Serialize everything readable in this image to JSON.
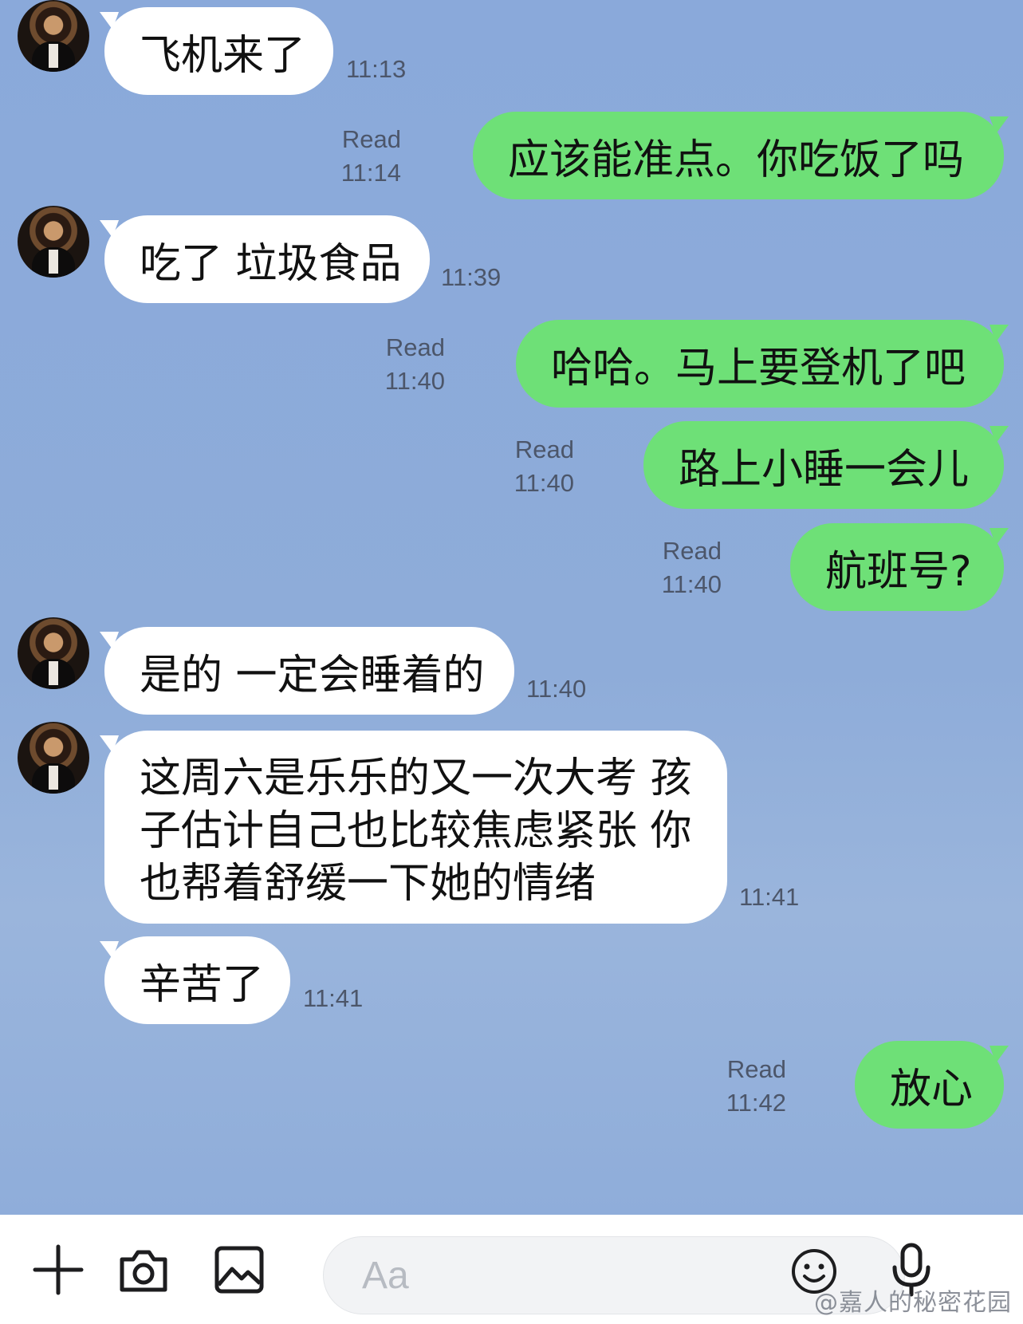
{
  "messages": [
    {
      "side": "in",
      "text": "飞机来了",
      "time": "11:13"
    },
    {
      "side": "out",
      "text": "应该能准点。你吃饭了吗",
      "read": "Read",
      "time": "11:14"
    },
    {
      "side": "in",
      "text": "吃了 垃圾食品",
      "time": "11:39"
    },
    {
      "side": "out",
      "text": "哈哈。马上要登机了吧",
      "read": "Read",
      "time": "11:40"
    },
    {
      "side": "out",
      "text": "路上小睡一会儿",
      "read": "Read",
      "time": "11:40"
    },
    {
      "side": "out",
      "text": "航班号?",
      "read": "Read",
      "time": "11:40"
    },
    {
      "side": "in",
      "text": "是的 一定会睡着的",
      "time": "11:40"
    },
    {
      "side": "in",
      "text": "这周六是乐乐的又一次大考 孩子估计自己也比较焦虑紧张 你也帮着舒缓一下她的情绪",
      "time": "11:41"
    },
    {
      "side": "in",
      "text": "辛苦了",
      "time": "11:41"
    },
    {
      "side": "out",
      "text": "放心",
      "read": "Read",
      "time": "11:42"
    }
  ],
  "input": {
    "placeholder": "Aa"
  },
  "toolbar": {
    "icons": [
      "plus-icon",
      "camera-icon",
      "image-icon",
      "emoji-icon",
      "microphone-icon"
    ]
  },
  "watermark": "@嘉人的秘密花园",
  "colors": {
    "background": "#8caad8",
    "incoming_bubble": "#ffffff",
    "outgoing_bubble": "#6ee077",
    "meta_text": "#4c566a"
  }
}
